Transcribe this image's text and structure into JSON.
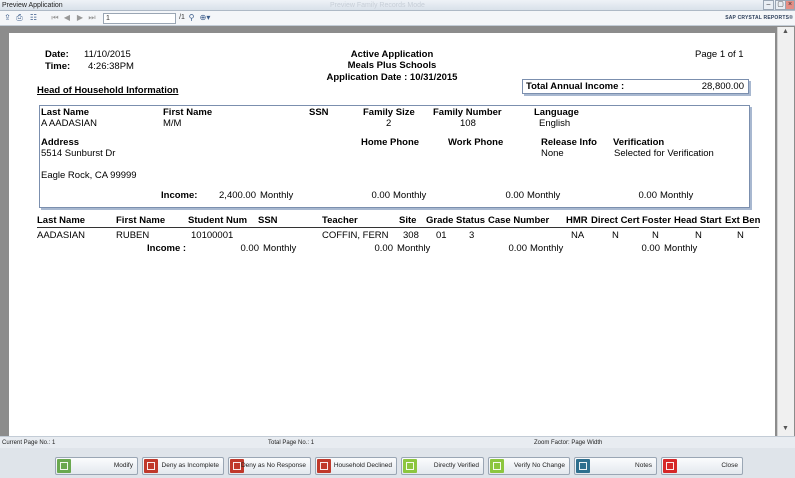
{
  "window": {
    "title": "Preview Application",
    "ghost_title": "Preview Family Records Mode"
  },
  "toolbar": {
    "page_input": "1",
    "page_suffix": "/1",
    "brand": "SAP CRYSTAL REPORTS®"
  },
  "report": {
    "date_label": "Date:",
    "date_value": "11/10/2015",
    "time_label": "Time:",
    "time_value": "4:26:38PM",
    "title": "Active Application",
    "org": "Meals Plus Schools",
    "app_date": "Application Date : 10/31/2015",
    "page": "Page 1 of 1",
    "hh_heading": "Head of Household Information",
    "total_income_label": "Total Annual Income :",
    "total_income_value": "28,800.00"
  },
  "household": {
    "h_last": "Last Name",
    "v_last": "A AADASIAN",
    "h_first": "First Name",
    "v_first": "M/M",
    "h_ssn": "SSN",
    "h_size": "Family Size",
    "v_size": "2",
    "h_number": "Family Number",
    "v_number": "108",
    "h_lang": "Language",
    "v_lang": "English",
    "h_address": "Address",
    "v_addr1": "5514 Sunburst Dr",
    "v_addr2": "Eagle Rock, CA  99999",
    "h_home": "Home Phone",
    "h_work": "Work Phone",
    "h_release": "Release Info",
    "v_release": "None",
    "h_verif": "Verification",
    "v_verif": "Selected for Verification",
    "income_label": "Income:",
    "income1": "2,400.00",
    "income2": "0.00",
    "income3": "0.00",
    "income4": "0.00",
    "monthly": "Monthly"
  },
  "students": {
    "headers": [
      "Last Name",
      "First Name",
      "Student Num",
      "SSN",
      "Teacher",
      "Site",
      "Grade",
      "Status",
      "Case Number",
      "HMR",
      "Direct Cert",
      "Foster",
      "Head Start",
      "Ext Ben"
    ],
    "row": {
      "last": "AADASIAN",
      "first": "RUBEN",
      "num": "10100001",
      "teacher": "COFFIN, FERN",
      "site": "308",
      "grade": "01",
      "status": "3",
      "hmr": "NA",
      "direct": "N",
      "foster": "N",
      "head": "N",
      "ext": "N"
    },
    "income_label": "Income :",
    "income1": "0.00",
    "income2": "0.00",
    "income3": "0.00",
    "income4": "0.00",
    "monthly": "Monthly"
  },
  "status": {
    "current": "Current Page No.: 1",
    "total": "Total Page No.: 1",
    "zoom": "Zoom Factor: Page Width"
  },
  "buttons": [
    {
      "label": "Modify",
      "color": "#6aa84f"
    },
    {
      "label": "Deny as Incomplete",
      "color": "#c0392b"
    },
    {
      "label": "Deny as No Response",
      "color": "#c0392b"
    },
    {
      "label": "Household Declined",
      "color": "#c0392b"
    },
    {
      "label": "Directly Verified",
      "color": "#8cc63f"
    },
    {
      "label": "Verify No Change",
      "color": "#8cc63f"
    },
    {
      "label": "Notes",
      "color": "#2e6f8e"
    },
    {
      "label": "Close",
      "color": "#d62728"
    }
  ]
}
